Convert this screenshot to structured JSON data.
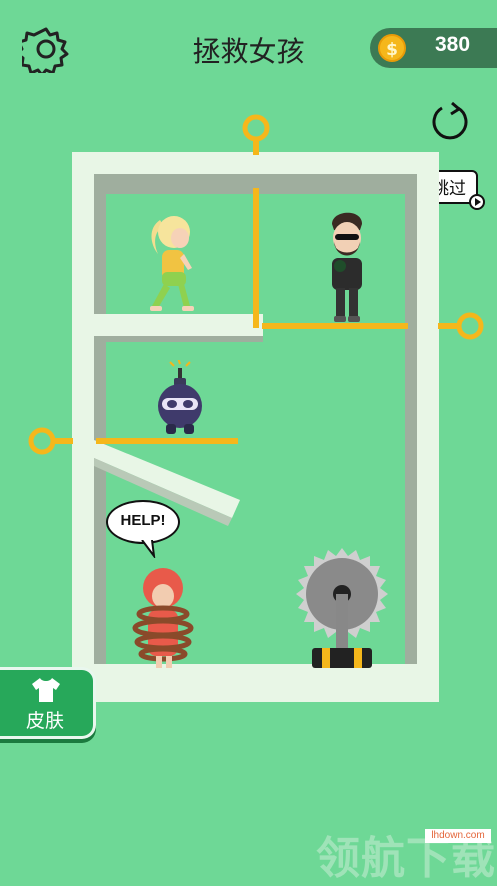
{
  "header": {
    "title": "拯救女孩",
    "coins": "380",
    "coin_symbol": "$"
  },
  "controls": {
    "skip_label": "跳过",
    "skin_label": "皮肤"
  },
  "scene": {
    "bubble_text": "HELP!"
  },
  "watermark": {
    "text": "领航下载",
    "url": "lhdown.com"
  },
  "colors": {
    "background": "#6ed896",
    "wall": "#e8f6e6",
    "pin": "#f5b71b",
    "coin_pill": "#3c7a54",
    "skin_button": "#27a85a"
  },
  "icons": [
    "gear-icon",
    "coin-icon",
    "restart-icon",
    "play-icon",
    "shirt-icon"
  ]
}
